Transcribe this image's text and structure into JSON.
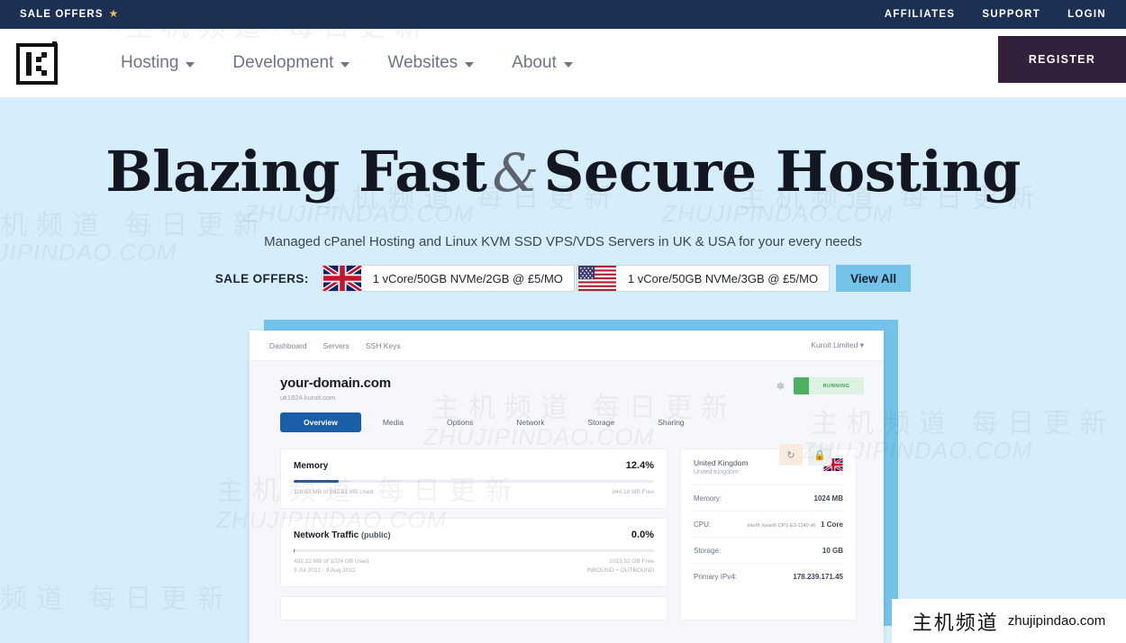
{
  "topbar": {
    "sale_offers_label": "SALE OFFERS",
    "star_icon": "star-icon",
    "links": [
      {
        "label": "AFFILIATES"
      },
      {
        "label": "SUPPORT"
      },
      {
        "label": "LOGIN"
      }
    ]
  },
  "nav": {
    "logo_alt": "kuroit-logo",
    "items": [
      {
        "label": "Hosting",
        "has_caret": true
      },
      {
        "label": "Development",
        "has_caret": true
      },
      {
        "label": "Websites",
        "has_caret": true
      },
      {
        "label": "About",
        "has_caret": true
      }
    ],
    "register_label": "REGISTER",
    "register_bg": "#33203a"
  },
  "hero": {
    "title_part1": "Blazing Fast",
    "title_amp": "&",
    "title_part2": "Secure Hosting",
    "subtitle": "Managed cPanel Hosting and Linux KVM SSD VPS/VDS Servers in UK & USA for your every needs",
    "bg_color": "#d6eefb",
    "offers_label": "SALE OFFERS:",
    "offers": [
      {
        "flag": "uk-flag-icon",
        "text": "1 vCore/50GB NVMe/2GB @ £5/MO"
      },
      {
        "flag": "us-flag-icon",
        "text": "1 vCore/50GB NVMe/3GB @ £5/MO"
      }
    ],
    "view_all_label": "View All",
    "view_all_bg": "#72c2ea"
  },
  "dashboard": {
    "topnav": {
      "items": [
        {
          "label": "Dashboard"
        },
        {
          "label": "Servers"
        },
        {
          "label": "SSH Keys"
        }
      ],
      "account": "Kuroit Limited ▾"
    },
    "domain": "your-domain.com",
    "hostname": "uk1824.kuroit.com",
    "status": "RUNNING",
    "status_color": "#4caf62",
    "gear_icon": "gear-icon",
    "refresh_icon": "refresh-icon",
    "lock_icon": "lock-icon",
    "tabs": [
      {
        "label": "Overview",
        "active": true
      },
      {
        "label": "Media",
        "active": false
      },
      {
        "label": "Options",
        "active": false
      },
      {
        "label": "Network",
        "active": false
      },
      {
        "label": "Storage",
        "active": false
      },
      {
        "label": "Sharing",
        "active": false
      }
    ],
    "cards": [
      {
        "title": "Memory",
        "title_muted": "",
        "percent": "12.4%",
        "fill_pct": 12.4,
        "note_left": "119.63 MB of 963.81 MB Used",
        "note_left2": "",
        "note_right": "844.18 MB Free",
        "note_right2": ""
      },
      {
        "title": "Network Traffic",
        "title_muted": "(public)",
        "percent": "0.0%",
        "fill_pct": 0.3,
        "note_left": "492.22 MB of 1024 GB Used",
        "note_left2": "9 Jul 2022 - 9 Aug 2022",
        "note_right": "1023.52 GB Free",
        "note_right2": "INBOUND + OUTBOUND"
      }
    ],
    "specs": {
      "country": "United Kingdom",
      "region": "United Kingdom",
      "flag": "uk-flag-icon",
      "rows": [
        {
          "key": "Memory:",
          "detail": "",
          "value": "1024 MB"
        },
        {
          "key": "CPU:",
          "detail": "Intel® Xeon® CPU E3-1240 v6",
          "value": "1 Core"
        },
        {
          "key": "Storage:",
          "detail": "",
          "value": "10 GB"
        },
        {
          "key": "Primary IPv4:",
          "detail": "",
          "value": "178.239.171.45"
        }
      ]
    }
  },
  "watermarks": {
    "cn_text": "主机频道 每日更新",
    "en_text": "ZHUJIPINDAO.COM",
    "brand_cn": "主机频道",
    "brand_en": "zhujipindao.com"
  }
}
